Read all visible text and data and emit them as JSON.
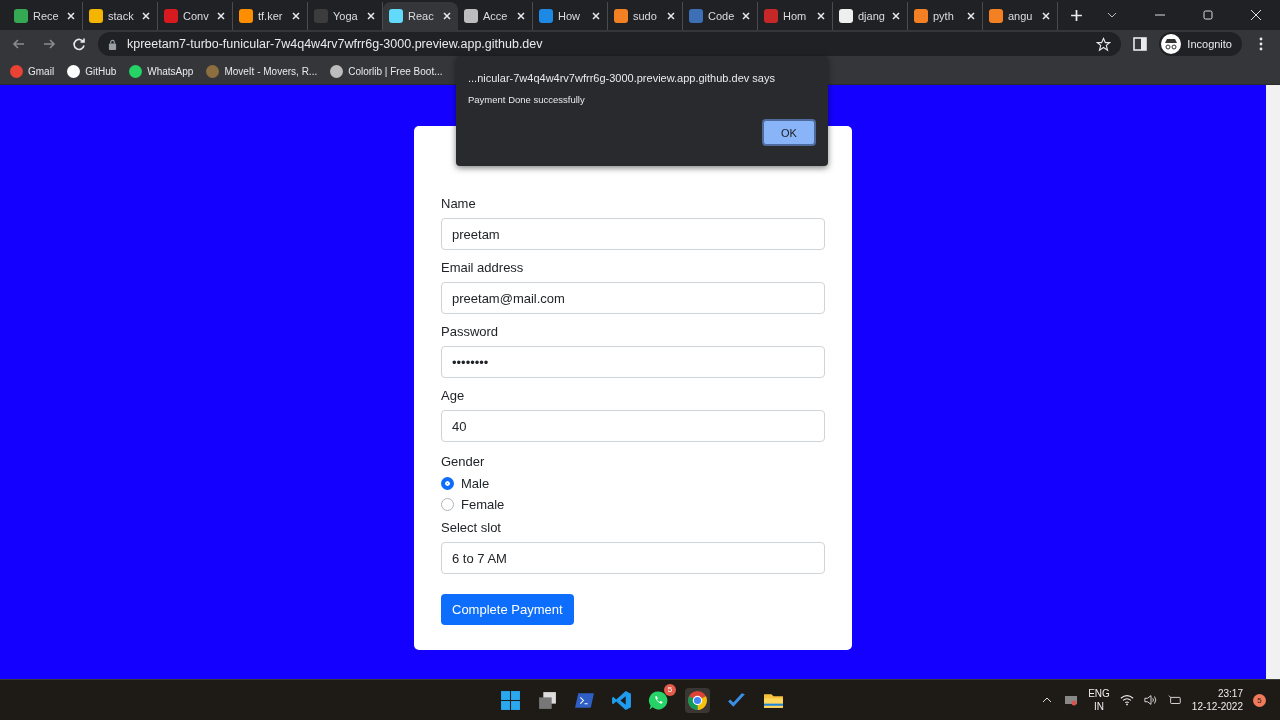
{
  "tabs": [
    {
      "label": "Rece",
      "color": "#34a853",
      "selected": false
    },
    {
      "label": "stack",
      "color": "#f4b400",
      "selected": false
    },
    {
      "label": "Conv",
      "color": "#d71920",
      "selected": false
    },
    {
      "label": "tf.ker",
      "color": "#ff8f00",
      "selected": false
    },
    {
      "label": "Yoga",
      "color": "#3c3c3c",
      "selected": false
    },
    {
      "label": "Reac",
      "color": "#61dafb",
      "selected": true
    },
    {
      "label": "Acce",
      "color": "#bdbdbd",
      "selected": false
    },
    {
      "label": "How",
      "color": "#1e88e5",
      "selected": false
    },
    {
      "label": "sudo",
      "color": "#f48024",
      "selected": false
    },
    {
      "label": "Code",
      "color": "#3d6fb6",
      "selected": false
    },
    {
      "label": "Hom",
      "color": "#c62828",
      "selected": false
    },
    {
      "label": "djang",
      "color": "#eeeeee",
      "selected": false
    },
    {
      "label": "pyth",
      "color": "#f48024",
      "selected": false
    },
    {
      "label": "angu",
      "color": "#f48024",
      "selected": false
    }
  ],
  "address": "kpreetam7-turbo-funicular-7w4q4w4rv7wfrr6g-3000.preview.app.github.dev",
  "profile": "Incognito",
  "bookmarks": [
    {
      "label": "Gmail",
      "color": "#ea4335"
    },
    {
      "label": "GitHub",
      "color": "#ffffff"
    },
    {
      "label": "WhatsApp",
      "color": "#25d366"
    },
    {
      "label": "MoveIt - Movers, R...",
      "color": "#8d6e3f"
    },
    {
      "label": "Colorlib | Free Boot...",
      "color": "#bdbdbd"
    }
  ],
  "form": {
    "fields": [
      {
        "label": "Name",
        "value": "preetam"
      },
      {
        "label": "Email address",
        "value": "preetam@mail.com"
      },
      {
        "label": "Password",
        "value": "••••••••"
      },
      {
        "label": "Age",
        "value": "40"
      }
    ],
    "gender": {
      "label": "Gender",
      "options": [
        {
          "label": "Male",
          "selected": true
        },
        {
          "label": "Female",
          "selected": false
        }
      ]
    },
    "slot": {
      "label": "Select slot",
      "value": "6 to 7 AM"
    },
    "submit": "Complete Payment"
  },
  "dialog": {
    "title": "...nicular-7w4q4w4rv7wfrr6g-3000.preview.app.github.dev says",
    "message": "Payment Done successfully",
    "button": "OK"
  },
  "taskbar": {
    "whatsapp_badge": "5",
    "language": "ENG",
    "region": "IN",
    "time": "23:17",
    "date": "12-12-2022",
    "notifications": "5"
  }
}
